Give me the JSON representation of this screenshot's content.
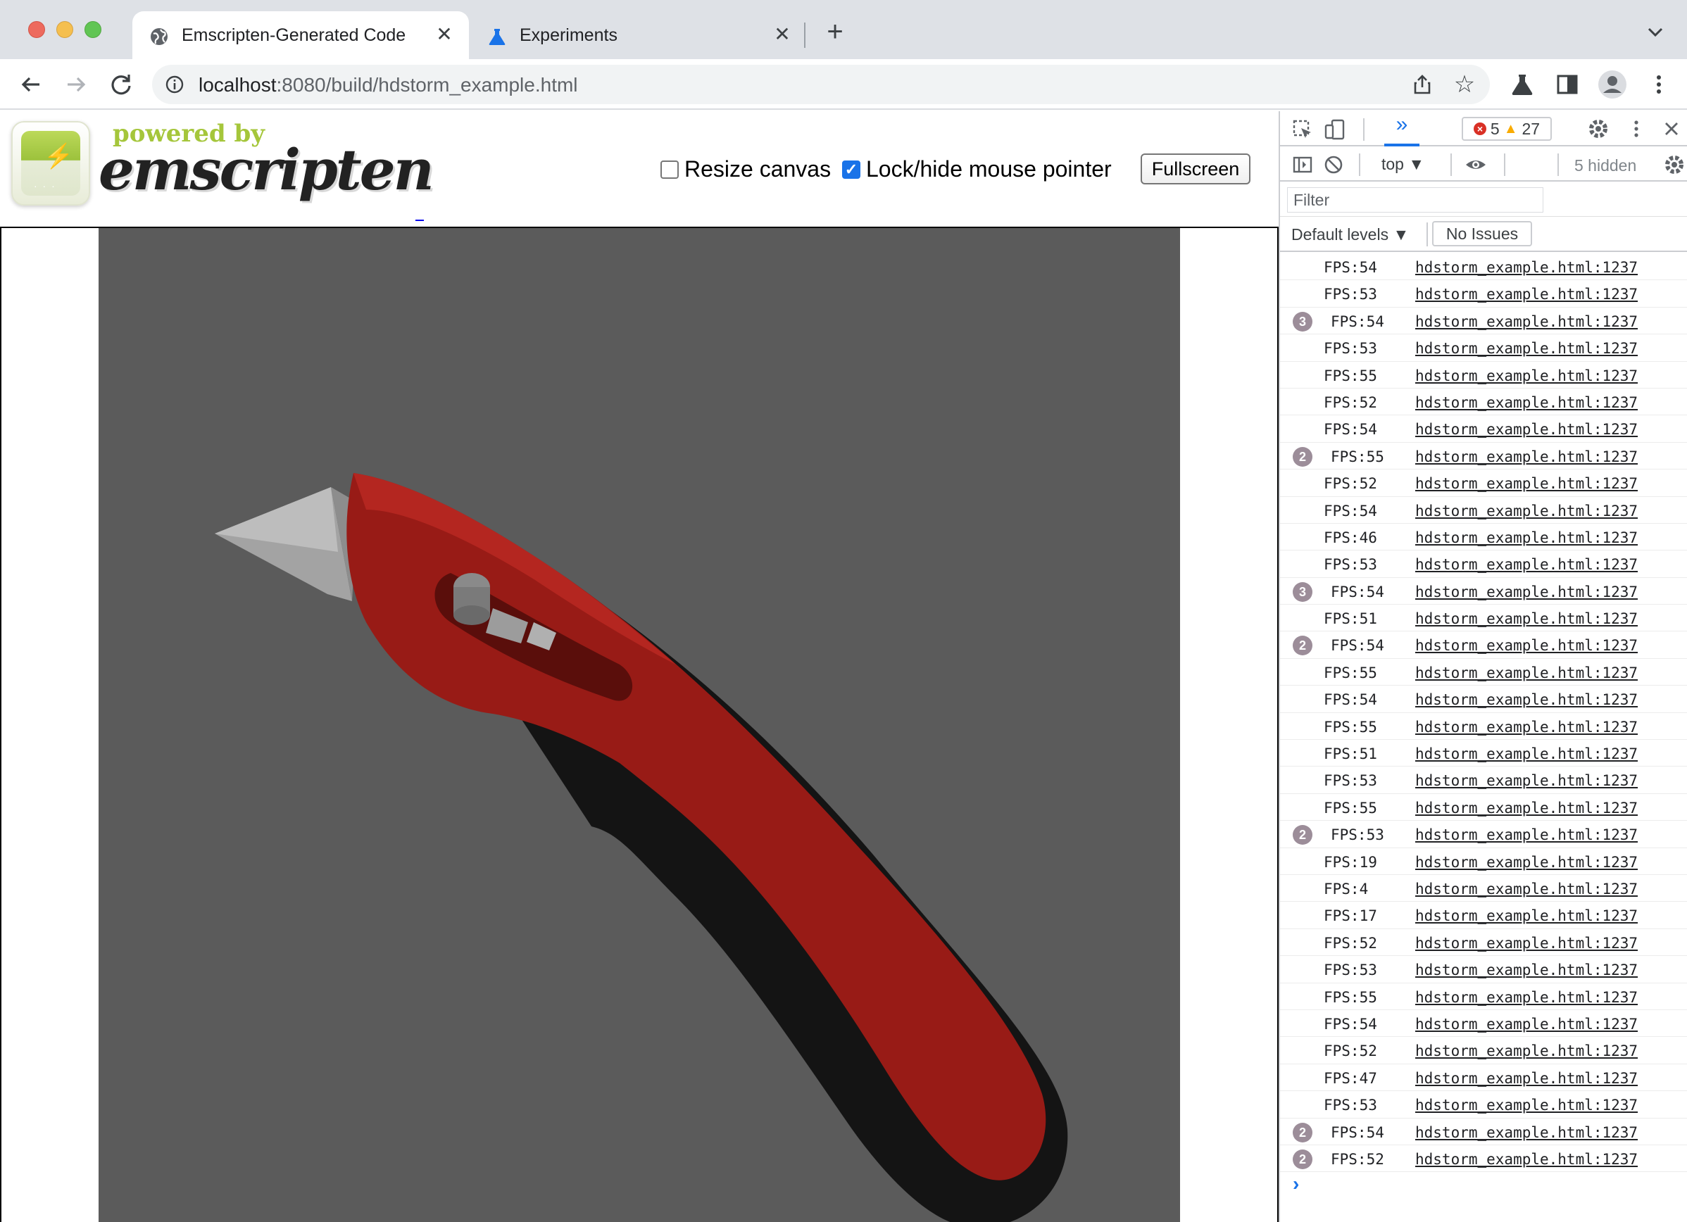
{
  "browser": {
    "tabs": [
      {
        "title": "Emscripten-Generated Code",
        "icon": "globe-icon",
        "active": true
      },
      {
        "title": "Experiments",
        "icon": "flask-icon",
        "active": false
      }
    ],
    "url_host": "localhost",
    "url_rest": ":8080/build/hdstorm_example.html"
  },
  "page": {
    "logo_powered": "powered by",
    "logo_name": "emscripten",
    "resize_label": "Resize canvas",
    "resize_checked": false,
    "lock_label": "Lock/hide mouse pointer",
    "lock_checked": true,
    "fullscreen_label": "Fullscreen",
    "canvas_bg": "#5b5b5b"
  },
  "devtools": {
    "more_tabs": "»",
    "errors": "5",
    "warnings": "27",
    "context": "top ▼",
    "hidden": "5 hidden",
    "filter_placeholder": "Filter",
    "levels": "Default levels ▼",
    "no_issues": "No Issues",
    "source": "hdstorm_example.html:1237",
    "logs": [
      {
        "msg": "FPS:54",
        "count": ""
      },
      {
        "msg": "FPS:53",
        "count": ""
      },
      {
        "msg": "FPS:54",
        "count": "3"
      },
      {
        "msg": "FPS:53",
        "count": ""
      },
      {
        "msg": "FPS:55",
        "count": ""
      },
      {
        "msg": "FPS:52",
        "count": ""
      },
      {
        "msg": "FPS:54",
        "count": ""
      },
      {
        "msg": "FPS:55",
        "count": "2"
      },
      {
        "msg": "FPS:52",
        "count": ""
      },
      {
        "msg": "FPS:54",
        "count": ""
      },
      {
        "msg": "FPS:46",
        "count": ""
      },
      {
        "msg": "FPS:53",
        "count": ""
      },
      {
        "msg": "FPS:54",
        "count": "3"
      },
      {
        "msg": "FPS:51",
        "count": ""
      },
      {
        "msg": "FPS:54",
        "count": "2"
      },
      {
        "msg": "FPS:55",
        "count": ""
      },
      {
        "msg": "FPS:54",
        "count": ""
      },
      {
        "msg": "FPS:55",
        "count": ""
      },
      {
        "msg": "FPS:51",
        "count": ""
      },
      {
        "msg": "FPS:53",
        "count": ""
      },
      {
        "msg": "FPS:55",
        "count": ""
      },
      {
        "msg": "FPS:53",
        "count": "2"
      },
      {
        "msg": "FPS:19",
        "count": ""
      },
      {
        "msg": "FPS:4",
        "count": ""
      },
      {
        "msg": "FPS:17",
        "count": ""
      },
      {
        "msg": "FPS:52",
        "count": ""
      },
      {
        "msg": "FPS:53",
        "count": ""
      },
      {
        "msg": "FPS:55",
        "count": ""
      },
      {
        "msg": "FPS:54",
        "count": ""
      },
      {
        "msg": "FPS:52",
        "count": ""
      },
      {
        "msg": "FPS:47",
        "count": ""
      },
      {
        "msg": "FPS:53",
        "count": ""
      },
      {
        "msg": "FPS:54",
        "count": "2"
      },
      {
        "msg": "FPS:52",
        "count": "2"
      }
    ],
    "prompt": "›"
  }
}
